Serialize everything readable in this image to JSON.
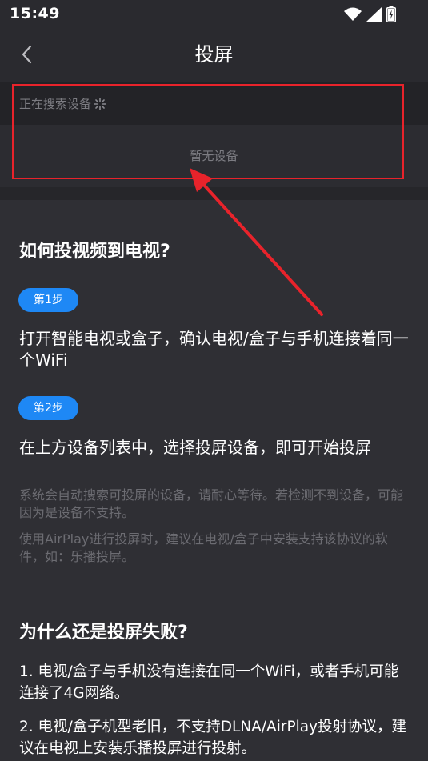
{
  "status_bar": {
    "time": "15:49",
    "icons": [
      "wifi-icon",
      "signal-icon",
      "battery-charging-icon"
    ]
  },
  "header": {
    "back_icon": "chevron-left-icon",
    "title": "投屏"
  },
  "devices": {
    "searching_label": "正在搜索设备",
    "loading_icon": "spinner-icon",
    "empty_label": "暂无设备"
  },
  "howto": {
    "title": "如何投视频到电视?",
    "steps": [
      {
        "badge": "第1步",
        "text": "打开智能电视或盒子，确认电视/盒子与手机连接着同一个WiFi"
      },
      {
        "badge": "第2步",
        "text": "在上方设备列表中，选择投屏设备，即可开始投屏"
      }
    ],
    "hints": [
      "系统会自动搜索可投屏的设备，请耐心等待。若检测不到设备，可能因为是设备不支持。",
      "使用AirPlay进行投屏时，建议在电视/盒子中安装支持该协议的软件，如：乐播投屏。"
    ]
  },
  "failure": {
    "title": "为什么还是投屏失败?",
    "reasons": [
      "1. 电视/盒子与手机没有连接在同一个WiFi，或者手机可能连接了4G网络。",
      "2. 电视/盒子机型老旧，不支持DLNA/AirPlay投射协议，建议在电视上安装乐播投屏进行投射。"
    ]
  },
  "colors": {
    "background": "#2f2f34",
    "accent": "#1e88f5",
    "annotation": "#e8232b",
    "muted_text": "#7c7c82"
  }
}
